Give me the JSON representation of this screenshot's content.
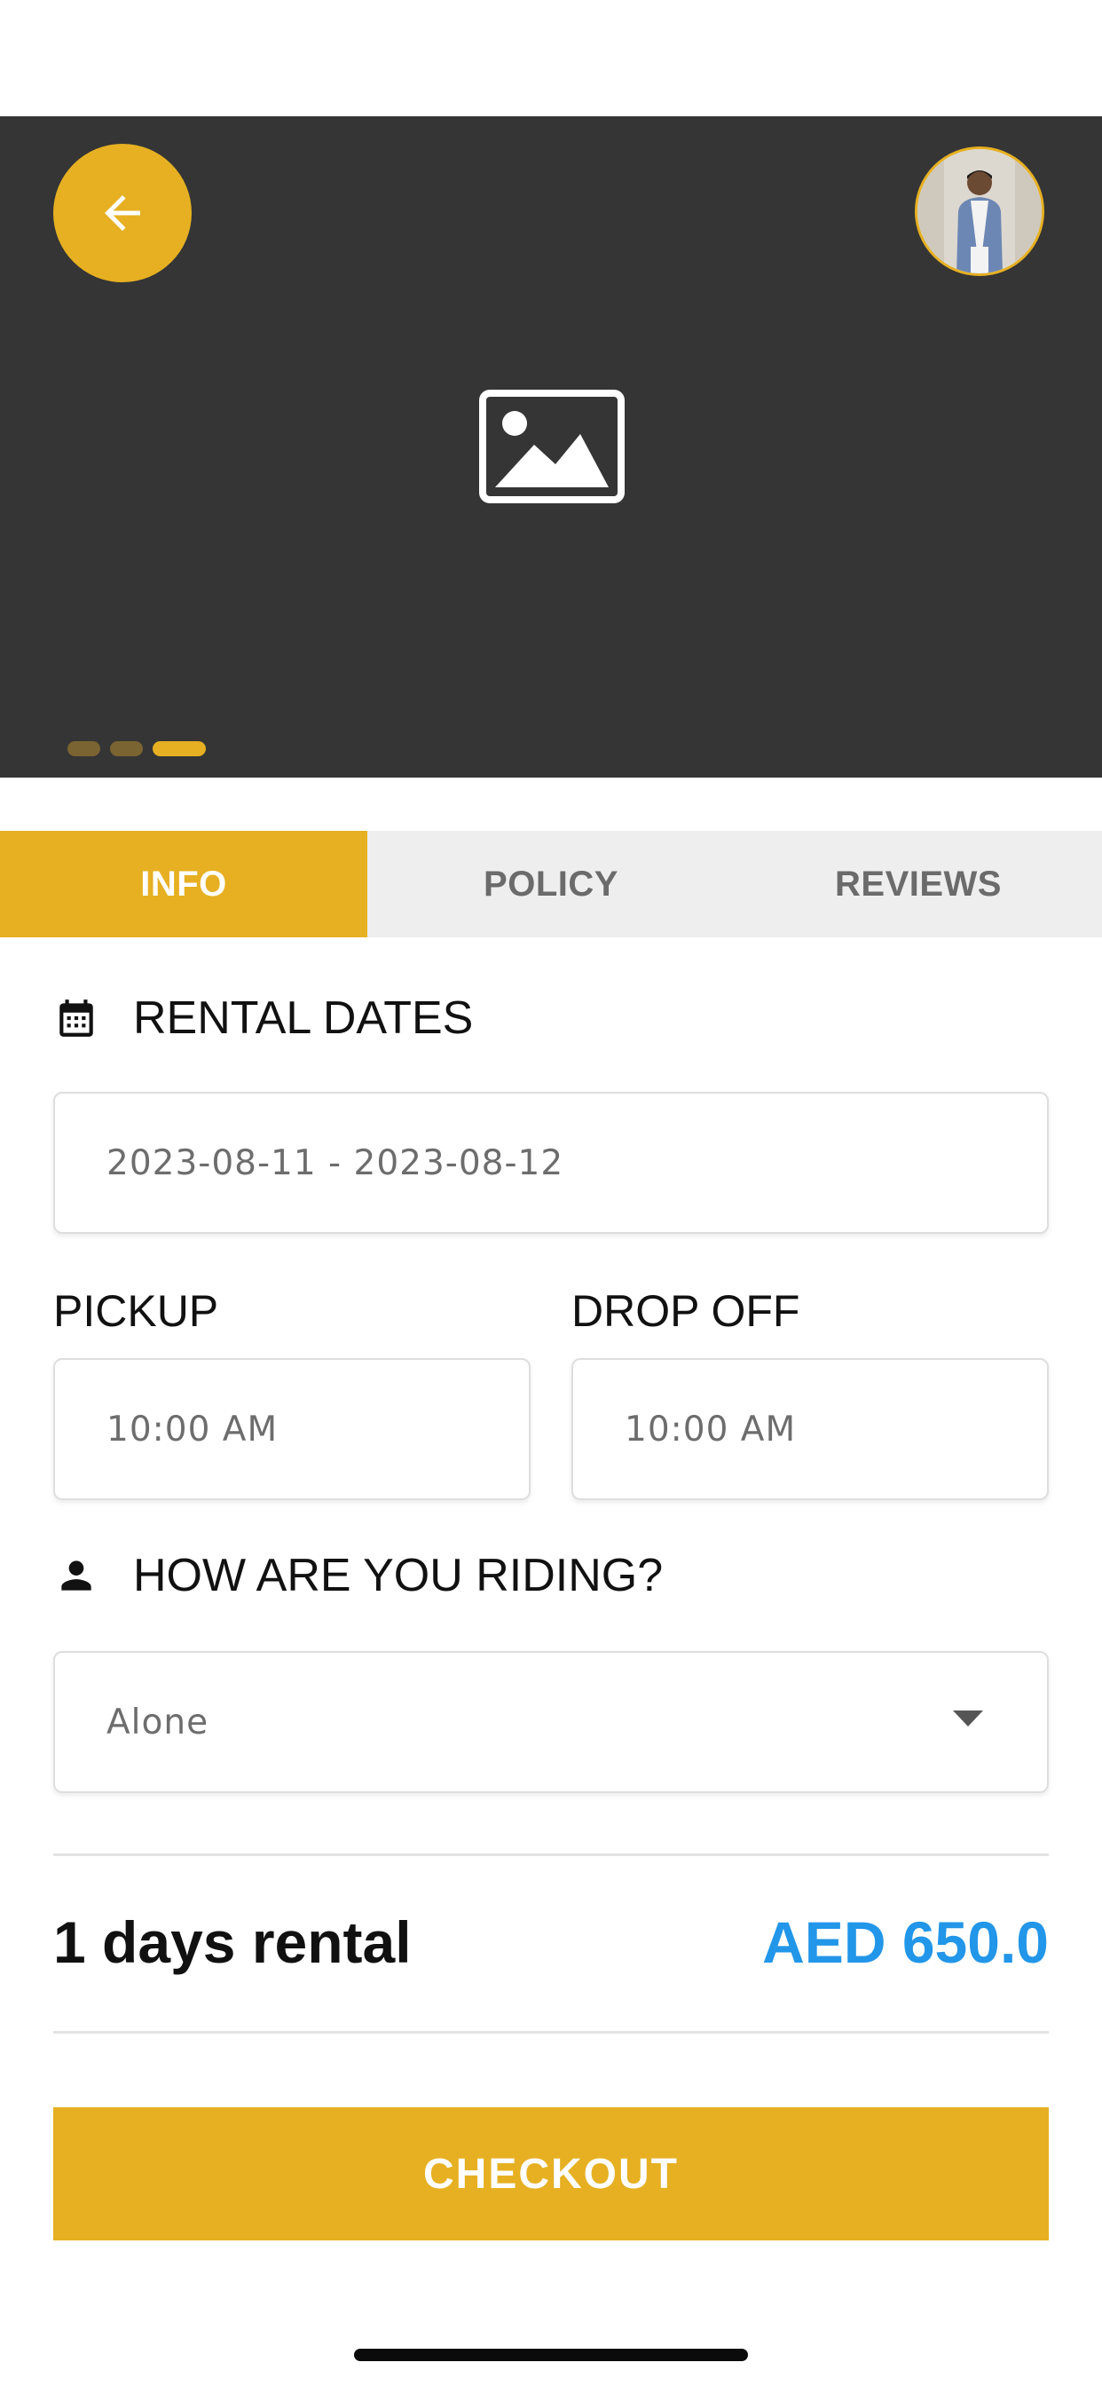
{
  "hero": {
    "dots": [
      {
        "active": false
      },
      {
        "active": false
      },
      {
        "active": true
      }
    ]
  },
  "tabs": [
    {
      "label": "INFO",
      "active": true
    },
    {
      "label": "POLICY",
      "active": false
    },
    {
      "label": "REVIEWS",
      "active": false
    }
  ],
  "rental_dates": {
    "heading": "RENTAL DATES",
    "value": "2023-08-11 - 2023-08-12"
  },
  "pickup": {
    "label": "PICKUP",
    "value": "10:00 AM"
  },
  "dropoff": {
    "label": "DROP OFF",
    "value": "10:00 AM"
  },
  "riding": {
    "heading": "HOW ARE YOU RIDING?",
    "selected": "Alone"
  },
  "summary": {
    "duration": "1 days rental",
    "price": "AED 650.0"
  },
  "checkout_label": "CHECKOUT",
  "colors": {
    "accent": "#E6B022",
    "hero_bg": "#353535",
    "price": "#2296E8"
  }
}
